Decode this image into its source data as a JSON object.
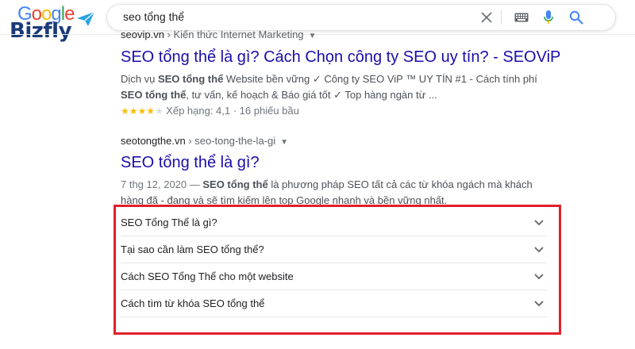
{
  "logo": {
    "google_text": "Google",
    "google_letter_colors": [
      "#4285f4",
      "#ea4335",
      "#fbbc05",
      "#4285f4",
      "#34a853",
      "#ea4335"
    ],
    "brand_text": "Bizfly",
    "brand_color": "#1a3a78",
    "plane_color": "#29a3e3"
  },
  "search": {
    "query": "seo tổng thể",
    "icons": [
      "close-icon",
      "keyboard-icon",
      "microphone-icon",
      "search-icon"
    ]
  },
  "results": [
    {
      "domain": "seovip.vn",
      "path": " › Kiến thức Internet Marketing",
      "title": "SEO tổng thể là gì? Cách Chọn công ty SEO uy tín? - SEOViP",
      "snippet_parts": [
        {
          "text": "Dịch vụ ",
          "bold": false
        },
        {
          "text": "SEO tổng thể",
          "bold": true
        },
        {
          "text": " Website bền vững ✓ Công ty SEO ViP ™ UY TÍN #1 - Cách tính phí ",
          "bold": false
        },
        {
          "text": "SEO tổng thể",
          "bold": true
        },
        {
          "text": ", tư vấn, kế hoạch & Báo giá tốt ✓ Top hàng ngàn từ ...",
          "bold": false
        }
      ],
      "rating": {
        "stars_filled": 4,
        "stars_total": 5,
        "text": "Xếp hạng: 4,1 · 16 phiếu bầu"
      }
    },
    {
      "domain": "seotongthe.vn",
      "path": " › seo-tong-the-la-gi",
      "title": "SEO tổng thể là gì?",
      "date": "7 thg 12, 2020 — ",
      "snippet_parts": [
        {
          "text": "SEO tổng thể",
          "bold": true
        },
        {
          "text": " là phương pháp SEO tất cả các từ khóa ngách mà khách hàng đã - đang và sẽ tìm kiếm lên top Google nhanh và bền vững nhất.",
          "bold": false
        }
      ]
    }
  ],
  "faq": [
    "SEO Tổng Thể là gì?",
    "Tại sao cần làm SEO tổng thể?",
    "Cách SEO Tổng Thể cho một website",
    "Cách tìm từ khóa SEO tổng thể"
  ],
  "colors": {
    "link": "#1a0dab",
    "highlight_border": "#e0202c",
    "star": "#fbbc04"
  }
}
